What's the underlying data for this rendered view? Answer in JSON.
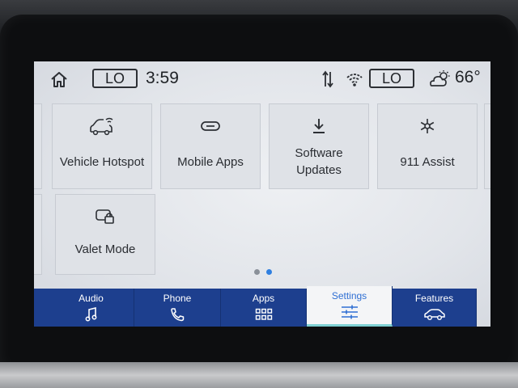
{
  "status_bar": {
    "left_lo_label": "LO",
    "time": "3:59",
    "right_lo_label": "LO",
    "temperature": "66°",
    "icons": [
      "home-icon",
      "data-transfer-icon",
      "wifi-hotspot-icon",
      "weather-cloudy-icon"
    ]
  },
  "tiles": [
    {
      "label": "Vehicle Hotspot",
      "icon": "car-wifi-icon"
    },
    {
      "label": "Mobile Apps",
      "icon": "link-icon"
    },
    {
      "label_line1": "Software",
      "label_line2": "Updates",
      "icon": "download-icon"
    },
    {
      "label": "911 Assist",
      "icon": "snowflake-asterisk-icon"
    },
    {
      "label": "Valet Mode",
      "icon": "car-lock-icon"
    }
  ],
  "pagination": {
    "pages": 2,
    "current": 2
  },
  "nav": {
    "items": [
      {
        "label": "Audio",
        "icon": "music-note-icon"
      },
      {
        "label": "Phone",
        "icon": "phone-icon"
      },
      {
        "label": "Apps",
        "icon": "apps-grid-icon"
      },
      {
        "label": "Settings",
        "icon": "sliders-icon",
        "active": true
      },
      {
        "label": "Features",
        "icon": "car-icon"
      }
    ]
  },
  "colors": {
    "nav_bg": "#1d3f8e",
    "active_text": "#2f6fd3",
    "active_underline": "#7fd0d3",
    "dot_inactive": "#8a9099",
    "dot_active": "#2f7fe0"
  }
}
